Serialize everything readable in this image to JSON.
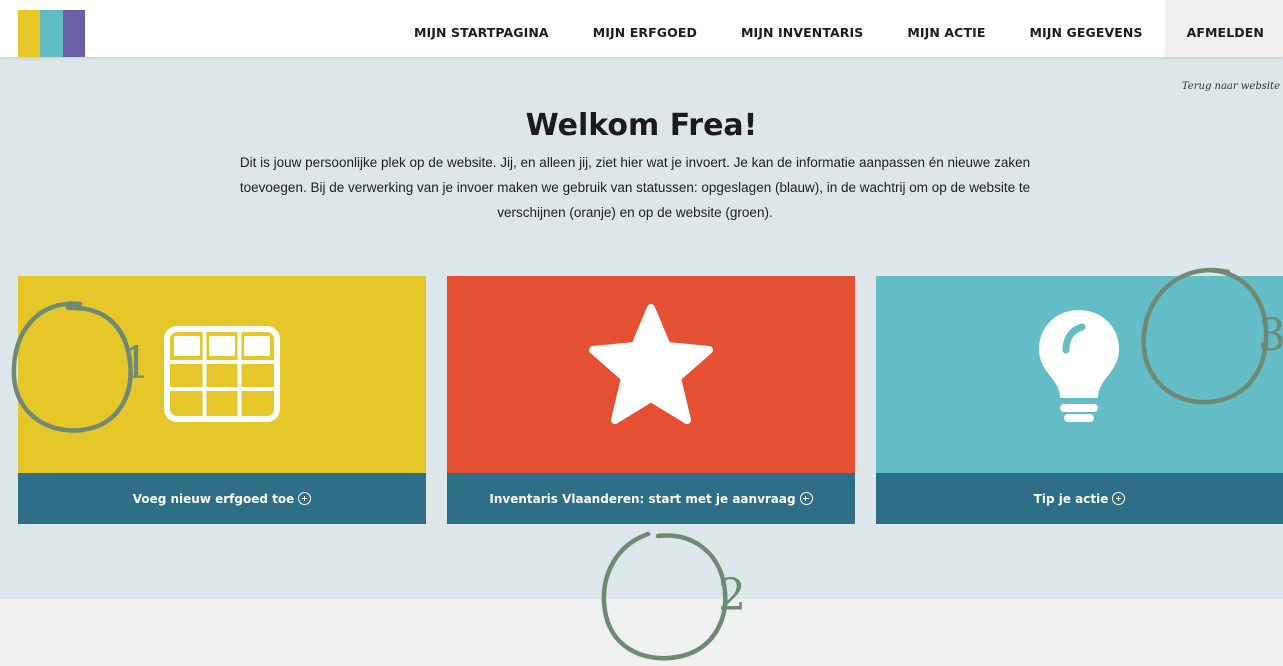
{
  "brand": {
    "colors": [
      "#e8c72b",
      "#62bcc6",
      "#6b5fa5"
    ]
  },
  "nav": {
    "items": [
      {
        "label": "MIJN STARTPAGINA"
      },
      {
        "label": "MIJN ERFGOED"
      },
      {
        "label": "MIJN INVENTARIS"
      },
      {
        "label": "MIJN ACTIE"
      },
      {
        "label": "MIJN GEGEVENS"
      },
      {
        "label": "AFMELDEN"
      }
    ]
  },
  "back_link": "Terug naar website",
  "welcome": "Welkom Frea!",
  "intro": "Dit is jouw persoonlijke plek op de website. Jij, en alleen jij, ziet hier wat je invoert. Je kan de informatie aanpassen én nieuwe zaken toevoegen. Bij de verwerking van je invoer maken we gebruik van statussen: opgeslagen (blauw), in de wachtrij om op de website te verschijnen (oranje) en op de website (groen).",
  "cards": [
    {
      "label": "Voeg nieuw erfgoed toe",
      "icon": "grid-icon",
      "color": "#e6c72a"
    },
    {
      "label": "Inventaris Vlaanderen: start met je aanvraag",
      "icon": "star-icon",
      "color": "#e65032"
    },
    {
      "label": "Tip je actie",
      "icon": "lightbulb-icon",
      "color": "#64bcc6"
    }
  ],
  "annotations": [
    "1",
    "2",
    "3"
  ]
}
